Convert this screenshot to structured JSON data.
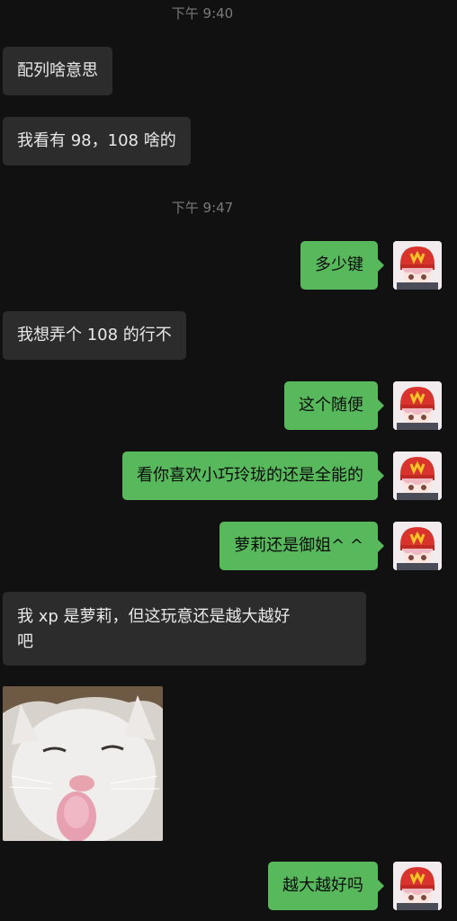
{
  "chat": {
    "timestamps": [
      "下午 9:40",
      "下午 9:47"
    ],
    "messages": [
      {
        "side": "in",
        "text": "配列啥意思"
      },
      {
        "side": "in",
        "text": "我看有 98，108 啥的"
      },
      {
        "side": "out",
        "text": "多少键"
      },
      {
        "side": "in",
        "text": "我想弄个 108 的行不"
      },
      {
        "side": "out",
        "text": "这个随便"
      },
      {
        "side": "out",
        "text": "看你喜欢小巧玲珑的还是全能的"
      },
      {
        "side": "out",
        "text": "萝莉还是御姐^ ^"
      },
      {
        "side": "in",
        "text_line1": "我 xp 是萝莉，但这玩意还是越大越好",
        "text_line2": "吧"
      },
      {
        "side": "in",
        "type": "sticker",
        "icon": "cat-sticker-icon"
      },
      {
        "side": "out",
        "text": "越大越好吗"
      }
    ]
  },
  "colors": {
    "background": "#111111",
    "incoming_bubble": "#2c2c2c",
    "outgoing_bubble": "#57b95c",
    "timestamp": "#7a7a7a"
  }
}
